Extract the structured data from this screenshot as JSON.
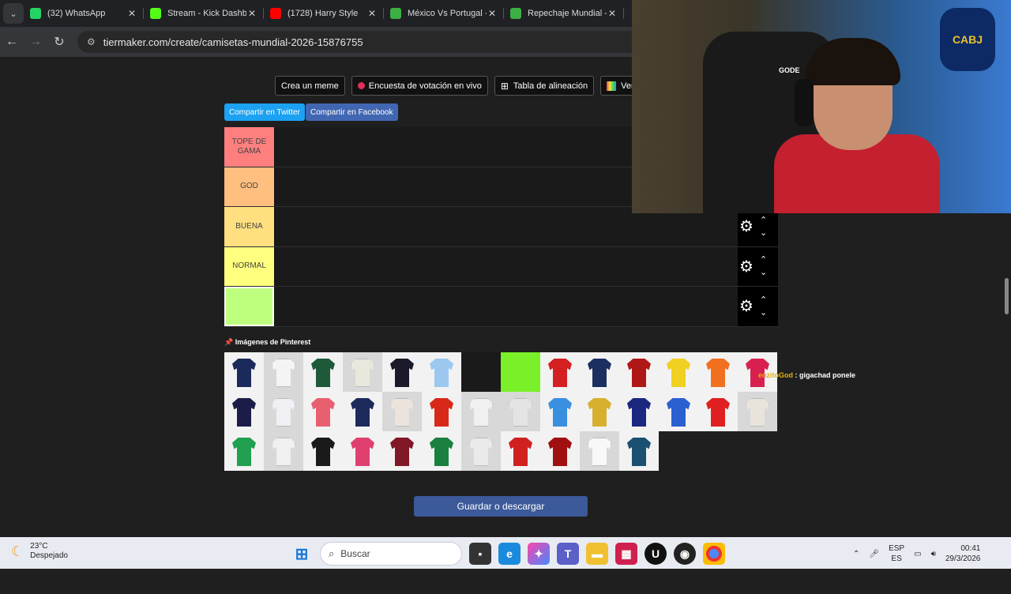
{
  "browser": {
    "tabs": [
      {
        "label": "(32) WhatsApp",
        "icon": "whatsapp-icon",
        "color": "#25d366"
      },
      {
        "label": "Stream - Kick Dashbo",
        "icon": "kick-icon",
        "color": "#53fc18"
      },
      {
        "label": "(1728) Harry Style",
        "icon": "youtube-icon",
        "color": "#ff0000"
      },
      {
        "label": "México Vs Portugal -",
        "icon": "soccer-icon",
        "color": "#3cb043"
      },
      {
        "label": "Repechaje Mundial -",
        "icon": "soccer-icon",
        "color": "#3cb043"
      }
    ],
    "url": "tiermaker.com/create/camisetas-mundial-2026-15876755"
  },
  "toolbar": {
    "meme": "Crea un meme",
    "poll": "Encuesta de votación en vivo",
    "lineup": "Tabla de alineación",
    "ranking": "Ver clas"
  },
  "share": {
    "twitter": "Compartir en Twitter",
    "facebook": "Compartir en Facebook"
  },
  "tiers": [
    {
      "label": "TOPE DE GAMA",
      "color": "#ff7f7f"
    },
    {
      "label": "GOD",
      "color": "#ffbf7f"
    },
    {
      "label": "BUENA",
      "color": "#ffdf7f"
    },
    {
      "label": "NORMAL",
      "color": "#ffff7f"
    },
    {
      "label": "",
      "color": "#bfff7f"
    }
  ],
  "pinterest_label": "Imágenes de Pinterest",
  "shirts": [
    "#1a2a5a",
    "#f4f4f4",
    "#1e5a3a",
    "#e8e8dc",
    "#1a1a2a",
    "#9cc8f0",
    "#1a1a1a",
    "#7af028",
    "#d42020",
    "#1c3060",
    "#b01818",
    "#f0d020",
    "#f07020",
    "#d82050",
    "#1c1c48",
    "#f0f0f4",
    "#e86070",
    "#1c2a5c",
    "#ece4dc",
    "#d82818",
    "#f0f0f0",
    "#e4e4e4",
    "#3a90e0",
    "#d8b030",
    "#1c2880",
    "#2a60d0",
    "#e02020",
    "#e8e4dc",
    "#20a050",
    "#f0f0f0",
    "#1a1a1a",
    "#e04070",
    "#801828",
    "#1a8040",
    "#eaeaea",
    "#d02020",
    "#a01010",
    "#f8f8f8",
    "#1a5070"
  ],
  "save_label": "Guardar o descargar",
  "chat": {
    "user": "enzitoGod",
    "message": " : gigachad ponele"
  },
  "webcam": {
    "poster": "CABJ",
    "headphones": "GODE"
  },
  "taskbar": {
    "temp": "23°C",
    "weather": "Despejado",
    "search": "Buscar",
    "lang1": "ESP",
    "lang2": "ES",
    "time": "00:41",
    "date": "29/3/2026"
  }
}
